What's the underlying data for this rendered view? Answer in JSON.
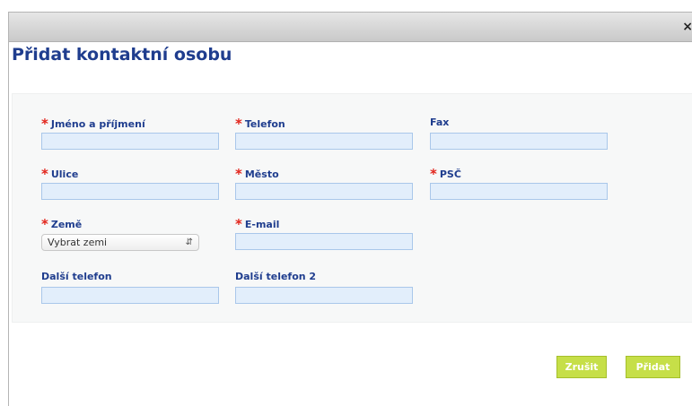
{
  "dialog": {
    "close_glyph": "×",
    "title": "Přidat kontaktní osobu"
  },
  "form": {
    "required_marker": "*",
    "fields": {
      "name": {
        "label": "Jméno a příjmení",
        "required": true,
        "value": ""
      },
      "phone": {
        "label": "Telefon",
        "required": true,
        "value": ""
      },
      "fax": {
        "label": "Fax",
        "required": false,
        "value": ""
      },
      "street": {
        "label": "Ulice",
        "required": true,
        "value": ""
      },
      "city": {
        "label": "Město",
        "required": true,
        "value": ""
      },
      "zip": {
        "label": "PSČ",
        "required": true,
        "value": ""
      },
      "country": {
        "label": "Země",
        "required": true,
        "selected": "Vybrat zemi"
      },
      "email": {
        "label": "E-mail",
        "required": true,
        "value": ""
      },
      "phone2": {
        "label": "Další telefon",
        "required": false,
        "value": ""
      },
      "phone3": {
        "label": "Další telefon 2",
        "required": false,
        "value": ""
      }
    }
  },
  "buttons": {
    "cancel": "Zrušit",
    "add": "Přidat"
  },
  "colors": {
    "title_blue": "#1f3d8e",
    "required_red": "#e2231a",
    "input_fill": "#e2eefb",
    "input_border": "#a9c7ea",
    "button_green": "#c6df48"
  },
  "icons": {
    "close": "close-icon",
    "select_arrows": "select-arrows-icon"
  }
}
